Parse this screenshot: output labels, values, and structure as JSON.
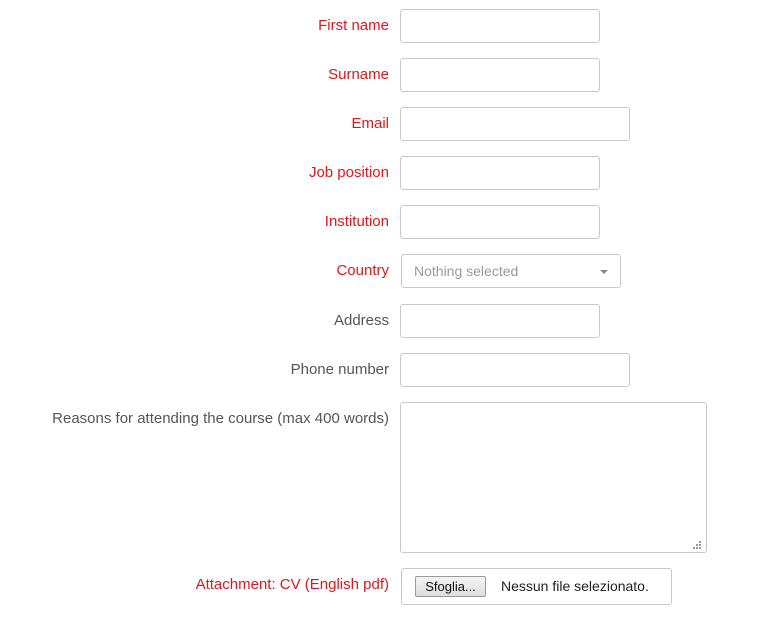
{
  "form": {
    "first_name": {
      "label": "First name",
      "value": ""
    },
    "surname": {
      "label": "Surname",
      "value": ""
    },
    "email": {
      "label": "Email",
      "value": ""
    },
    "job_position": {
      "label": "Job position",
      "value": ""
    },
    "institution": {
      "label": "Institution",
      "value": ""
    },
    "country": {
      "label": "Country",
      "selected": "Nothing selected"
    },
    "address": {
      "label": "Address",
      "value": ""
    },
    "phone": {
      "label": "Phone number",
      "value": ""
    },
    "reasons": {
      "label": "Reasons for attending the course (max 400 words)",
      "value": ""
    },
    "attachment": {
      "label": "Attachment: CV (English pdf)",
      "browse_label": "Sfoglia...",
      "status": "Nessun file selezionato."
    }
  },
  "colors": {
    "required_label": "#e8131a",
    "optional_label": "#555555",
    "border": "#c9c9c9",
    "placeholder": "#999999"
  },
  "icons": {
    "country_dropdown": "caret-down-icon",
    "textarea_resize": "resize-grip-icon"
  }
}
